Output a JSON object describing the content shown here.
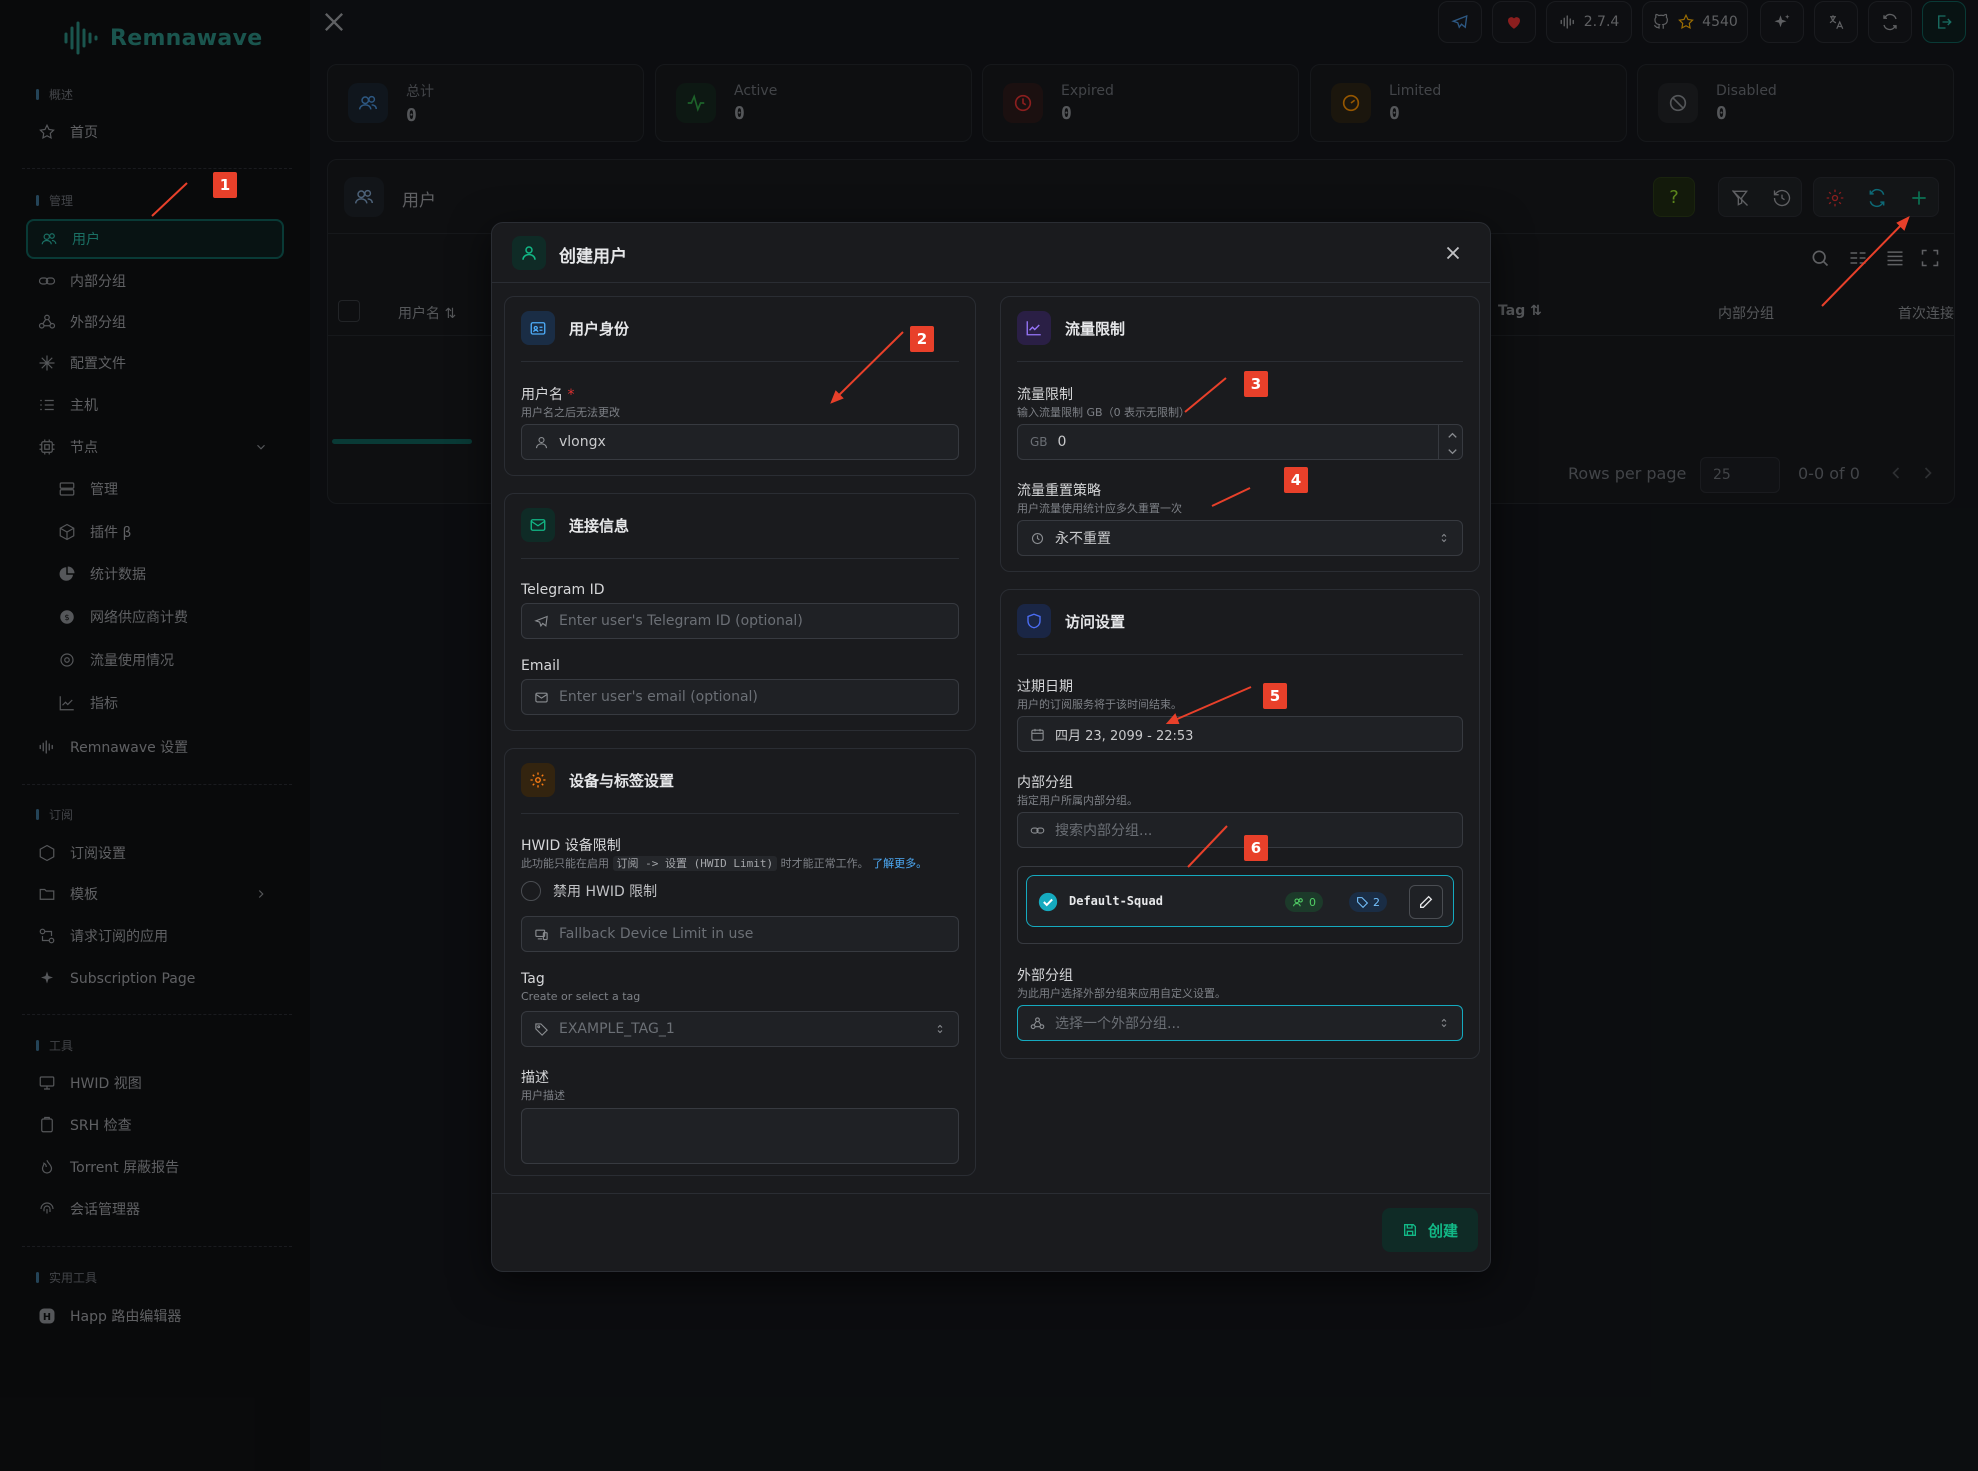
{
  "brand": {
    "name": "Remnawave"
  },
  "sidebar": {
    "sections": [
      {
        "label": "概述"
      },
      {
        "label": "管理"
      },
      {
        "label": "订阅"
      },
      {
        "label": "工具"
      },
      {
        "label": "实用工具"
      }
    ],
    "items": [
      {
        "label": "首页",
        "icon": "star-icon"
      },
      {
        "label": "用户",
        "icon": "users-icon"
      },
      {
        "label": "内部分组",
        "icon": "link-icon"
      },
      {
        "label": "外部分组",
        "icon": "webhook-icon"
      },
      {
        "label": "配置文件",
        "icon": "config-icon"
      },
      {
        "label": "主机",
        "icon": "list-icon"
      },
      {
        "label": "节点",
        "icon": "cpu-icon"
      },
      {
        "label": "管理",
        "icon": "server-icon"
      },
      {
        "label": "插件 β",
        "icon": "cube-icon"
      },
      {
        "label": "统计数据",
        "icon": "pie-icon"
      },
      {
        "label": "网络供应商计费",
        "icon": "coin-icon"
      },
      {
        "label": "流量使用情况",
        "icon": "gauge-icon"
      },
      {
        "label": "指标",
        "icon": "chart-icon"
      },
      {
        "label": "Remnawave 设置",
        "icon": "wave-icon"
      },
      {
        "label": "订阅设置",
        "icon": "hexagon-icon"
      },
      {
        "label": "模板",
        "icon": "folder-icon"
      },
      {
        "label": "请求订阅的应用",
        "icon": "apps-icon"
      },
      {
        "label": "Subscription Page",
        "icon": "sparkle-icon"
      },
      {
        "label": "HWID 视图",
        "icon": "monitor-icon"
      },
      {
        "label": "SRH 检查",
        "icon": "clipboard-icon"
      },
      {
        "label": "Torrent 屏蔽报告",
        "icon": "flame-icon"
      },
      {
        "label": "会话管理器",
        "icon": "fingerprint-icon"
      },
      {
        "label": "Happ 路由编辑器",
        "icon": "happ-icon"
      }
    ]
  },
  "toolbar": {
    "version": "2.7.4",
    "stars": "4540"
  },
  "stats": [
    {
      "label": "总计",
      "value": "0"
    },
    {
      "label": "Active",
      "value": "0"
    },
    {
      "label": "Expired",
      "value": "0"
    },
    {
      "label": "Limited",
      "value": "0"
    },
    {
      "label": "Disabled",
      "value": "0"
    }
  ],
  "users_panel": {
    "title": "用户",
    "columns": [
      "用户名",
      "Tag",
      "内部分组",
      "首次连接"
    ],
    "rows_per_page_label": "Rows per page",
    "rows_per_page": "25",
    "range": "0-0 of 0"
  },
  "modal": {
    "title": "创建用户",
    "identity": {
      "title": "用户身份",
      "username_label": "用户名",
      "username_required": "*",
      "username_desc": "用户名之后无法更改",
      "username_value": "vlongx"
    },
    "contact": {
      "title": "连接信息",
      "telegram_label": "Telegram ID",
      "telegram_placeholder": "Enter user's Telegram ID (optional)",
      "email_label": "Email",
      "email_placeholder": "Enter user's email (optional)"
    },
    "device": {
      "title": "设备与标签设置",
      "hwid_label": "HWID 设备限制",
      "hwid_desc_a": "此功能只能在启用",
      "hwid_desc_code": "订阅 -> 设置 (HWID Limit)",
      "hwid_desc_b": "时才能正常工作。",
      "hwid_learn_more": "了解更多。",
      "hwid_disable_label": "禁用 HWID 限制",
      "fallback_placeholder": "Fallback Device Limit in use",
      "tag_label": "Tag",
      "tag_desc": "Create or select a tag",
      "tag_placeholder": "EXAMPLE_TAG_1",
      "desc_label": "描述",
      "desc_desc": "用户描述"
    },
    "traffic": {
      "title": "流量限制",
      "limit_label": "流量限制",
      "limit_desc": "输入流量限制 GB（0 表示无限制）",
      "limit_unit": "GB",
      "limit_value": "0",
      "reset_label": "流量重置策略",
      "reset_desc": "用户流量使用统计应多久重置一次",
      "reset_value": "永不重置"
    },
    "access": {
      "title": "访问设置",
      "expire_label": "过期日期",
      "expire_desc": "用户的订阅服务将于该时间结束。",
      "expire_value": "四月 23, 2099 - 22:53",
      "internal_label": "内部分组",
      "internal_desc": "指定用户所属内部分组。",
      "internal_placeholder": "搜索内部分组...",
      "squad_name": "Default-Squad",
      "squad_users": "0",
      "squad_inbounds": "2",
      "external_label": "外部分组",
      "external_desc": "为此用户选择外部分组来应用自定义设置。",
      "external_placeholder": "选择一个外部分组..."
    },
    "create_label": "创建"
  },
  "annotations": [
    "1",
    "2",
    "3",
    "4",
    "5",
    "6"
  ],
  "colors": {
    "accent": "#12b886",
    "annotation": "#e8402a"
  }
}
